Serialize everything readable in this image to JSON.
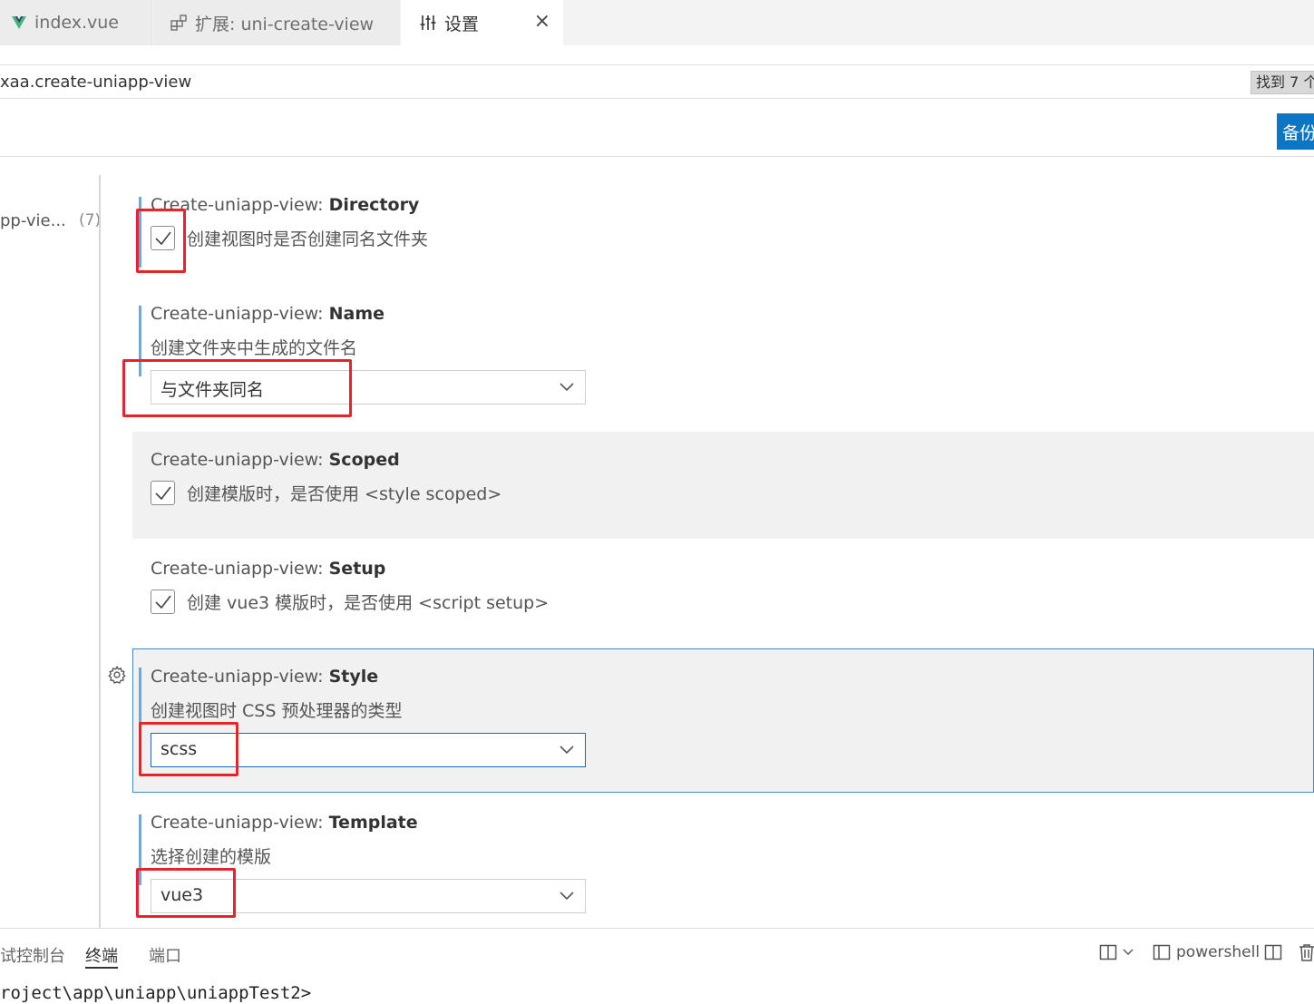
{
  "tabs": [
    {
      "label": "index.vue",
      "icon": "vue-icon"
    },
    {
      "label": "扩展: uni-create-view",
      "icon": "extensions-icon"
    },
    {
      "label": "设置",
      "icon": "settings-sliders-icon",
      "active": true
    }
  ],
  "search": {
    "value": "xaa.create-uniapp-view",
    "found": "找到 7 个"
  },
  "backup_label": "备份",
  "tree": {
    "item": "pp-vie...",
    "count": "(7)"
  },
  "settings": {
    "directory": {
      "prefix": "Create-uniapp-view: ",
      "name": "Directory",
      "label": "创建视图时是否创建同名文件夹",
      "checked": true
    },
    "name": {
      "prefix": "Create-uniapp-view: ",
      "name": "Name",
      "desc": "创建文件夹中生成的文件名",
      "value": "与文件夹同名"
    },
    "scoped": {
      "prefix": "Create-uniapp-view: ",
      "name": "Scoped",
      "label": "创建模版时，是否使用 <style scoped>",
      "checked": true
    },
    "setup": {
      "prefix": "Create-uniapp-view: ",
      "name": "Setup",
      "label": "创建 vue3 模版时，是否使用 <script setup>",
      "checked": true
    },
    "style": {
      "prefix": "Create-uniapp-view: ",
      "name": "Style",
      "desc": "创建视图时 CSS 预处理器的类型",
      "value": "scss"
    },
    "template": {
      "prefix": "Create-uniapp-view: ",
      "name": "Template",
      "desc": "选择创建的模版",
      "value": "vue3"
    }
  },
  "panel": {
    "tabs": [
      "试控制台",
      "终端",
      "端口"
    ],
    "active_tab": "终端",
    "shell": "powershell",
    "terminal_line": "roject\\app\\uniapp\\uniappTest2>"
  },
  "colors": {
    "accent": "#0a76c4",
    "annotation": "#e8232a",
    "vue_green": "#41b883"
  }
}
